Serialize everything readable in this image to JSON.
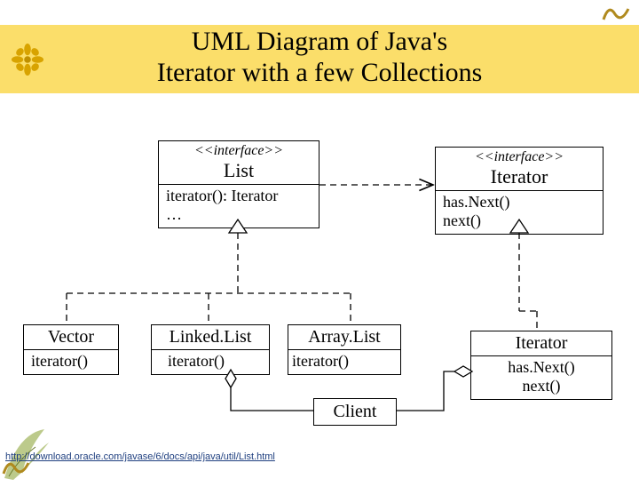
{
  "title_line1": "UML Diagram of Java's",
  "title_line2": "Iterator with a few Collections",
  "list_box": {
    "stereo": "<<interface>>",
    "name": "List",
    "ops": "iterator(): Iterator\n…"
  },
  "iterator_iface": {
    "stereo": "<<interface>>",
    "name": "Iterator",
    "ops": "has.Next()\nnext()"
  },
  "vector_box": {
    "name": "Vector",
    "ops": "iterator()"
  },
  "linkedlist_box": {
    "name": "Linked.List",
    "ops": "iterator()"
  },
  "arraylist_box": {
    "name": "Array.List",
    "ops": "iterator()"
  },
  "client_box": {
    "name": "Client"
  },
  "concrete_iter": {
    "name": "Iterator",
    "ops": "has.Next()\nnext()"
  },
  "footer_link": "http://download.oracle.com/javase/6/docs/api/java/util/List.html"
}
